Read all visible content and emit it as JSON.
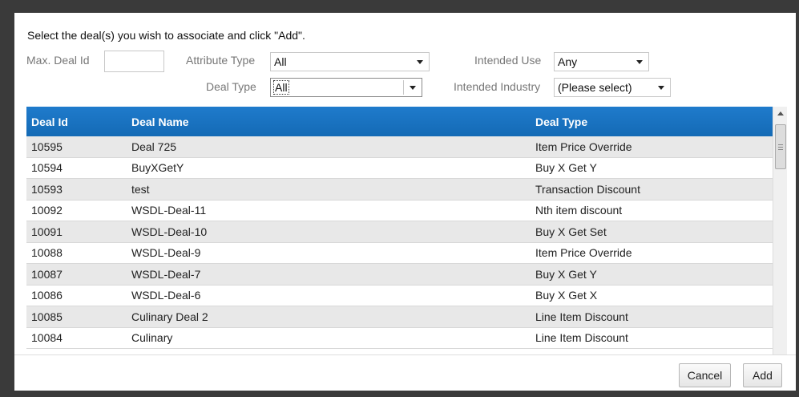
{
  "instructions": "Select the deal(s) you wish to associate and click \"Add\".",
  "filters": {
    "max_deal_id_label": "Max. Deal Id",
    "max_deal_id_value": "",
    "attribute_type_label": "Attribute Type",
    "attribute_type_value": "All",
    "intended_use_label": "Intended Use",
    "intended_use_value": "Any",
    "deal_type_label": "Deal Type",
    "deal_type_value": "All",
    "intended_industry_label": "Intended Industry",
    "intended_industry_value": "(Please select)"
  },
  "table": {
    "headers": [
      "Deal Id",
      "Deal Name",
      "Deal Type"
    ],
    "rows": [
      [
        "10595",
        "Deal 725",
        "Item Price Override"
      ],
      [
        "10594",
        "BuyXGetY",
        "Buy X Get Y"
      ],
      [
        "10593",
        "test",
        "Transaction Discount"
      ],
      [
        "10092",
        "WSDL-Deal-11",
        "Nth item discount"
      ],
      [
        "10091",
        "WSDL-Deal-10",
        "Buy X Get Set"
      ],
      [
        "10088",
        "WSDL-Deal-9",
        "Item Price Override"
      ],
      [
        "10087",
        "WSDL-Deal-7",
        "Buy X Get Y"
      ],
      [
        "10086",
        "WSDL-Deal-6",
        "Buy X Get X"
      ],
      [
        "10085",
        "Culinary Deal 2",
        "Line Item Discount"
      ],
      [
        "10084",
        "Culinary",
        "Line Item Discount"
      ]
    ]
  },
  "buttons": {
    "cancel": "Cancel",
    "add": "Add"
  },
  "colors": {
    "header_bg": "#1a73c2",
    "alt_row": "#e8e8e8"
  }
}
